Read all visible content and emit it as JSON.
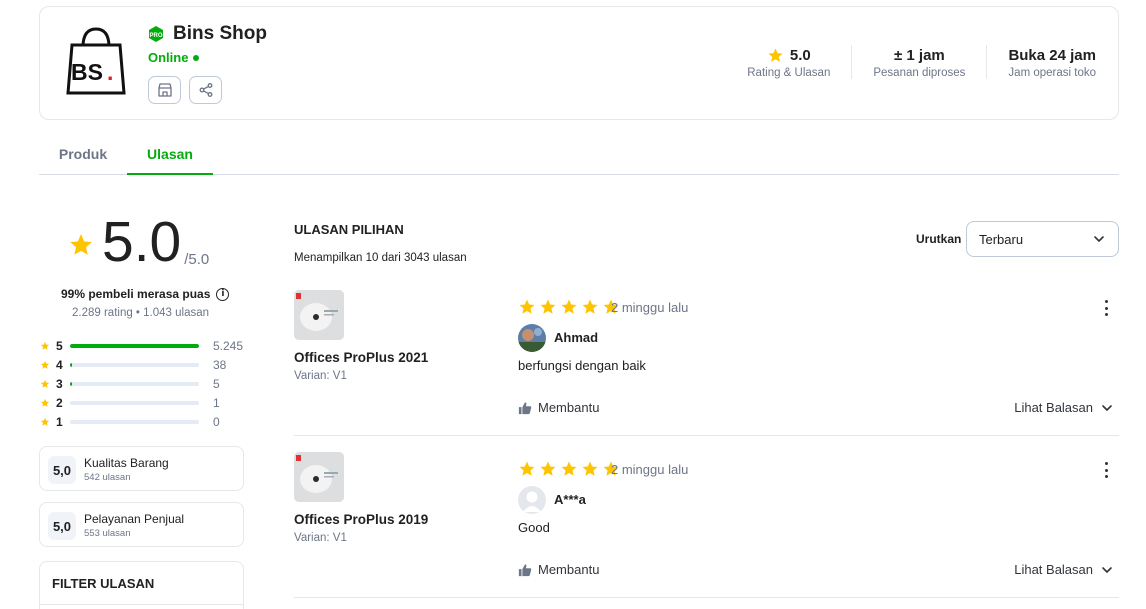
{
  "shop": {
    "name": "Bins Shop",
    "status": "Online",
    "logo_text": "BS.",
    "badge": "PRO"
  },
  "stats": [
    {
      "value": "5.0",
      "label": "Rating & Ulasan"
    },
    {
      "value": "± 1 jam",
      "label": "Pesanan diproses"
    },
    {
      "value": "Buka 24 jam",
      "label": "Jam operasi toko"
    }
  ],
  "tabs": [
    {
      "label": "Produk",
      "active": false
    },
    {
      "label": "Ulasan",
      "active": true
    }
  ],
  "summary": {
    "rating": "5.0",
    "out_of": "/5.0",
    "satisfaction": "99% pembeli merasa puas",
    "counts": "2.289 rating • 1.043 ulasan",
    "distribution": [
      {
        "star": "5",
        "count": "5.245",
        "fraction": 1.0
      },
      {
        "star": "4",
        "count": "38",
        "fraction": 0.01
      },
      {
        "star": "3",
        "count": "5",
        "fraction": 0.002
      },
      {
        "star": "2",
        "count": "1",
        "fraction": 0
      },
      {
        "star": "1",
        "count": "0",
        "fraction": 0
      }
    ],
    "quality": [
      {
        "score": "5,0",
        "title": "Kualitas Barang",
        "sub": "542 ulasan"
      },
      {
        "score": "5,0",
        "title": "Pelayanan Penjual",
        "sub": "553 ulasan"
      }
    ],
    "filter_title": "FILTER ULASAN"
  },
  "reviews_section": {
    "heading": "ULASAN PILIHAN",
    "count_text": "Menampilkan 10 dari 3043 ulasan",
    "sort_label": "Urutkan",
    "sort_value": "Terbaru"
  },
  "reviews": [
    {
      "product": "Offices ProPlus 2021",
      "variant": "Varian: V1",
      "stars": 5,
      "time": "2 minggu lalu",
      "user": "Ahmad",
      "text": "berfungsi dengan baik",
      "helpful": "Membantu",
      "replies": "Lihat Balasan"
    },
    {
      "product": "Offices ProPlus 2019",
      "variant": "Varian: V1",
      "stars": 5,
      "time": "2 minggu lalu",
      "user": "A***a",
      "text": "Good",
      "helpful": "Membantu",
      "replies": "Lihat Balasan"
    }
  ],
  "colors": {
    "accent": "#03ac0e",
    "star": "#ffc400",
    "muted": "#6d7588"
  }
}
